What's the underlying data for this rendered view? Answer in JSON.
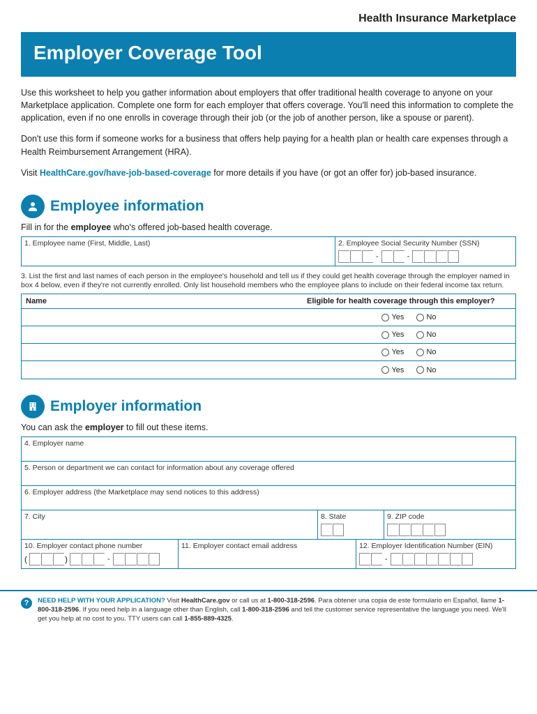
{
  "brand": "Health Insurance Marketplace",
  "title": "Employer Coverage Tool",
  "intro": {
    "p1": "Use this worksheet to help you gather information about employers that offer traditional health coverage to anyone on your Marketplace application. Complete one form for each employer that offers coverage. You'll need this information to complete the application, even if no one enrolls in coverage through their job (or the job of another person, like a spouse or parent).",
    "p2": "Don't use this form if someone works for a business that offers help paying for a health plan or health care expenses through a Health Reimbursement Arrangement (HRA).",
    "p3a": "Visit ",
    "p3link": "HealthCare.gov/have-job-based-coverage",
    "p3b": " for more details if you have (or got an offer for) job-based insurance."
  },
  "employee": {
    "heading": "Employee information",
    "sub_pre": "Fill in for the ",
    "sub_bold": "employee",
    "sub_post": " who's offered job-based health coverage.",
    "f1": "1. Employee name (First, Middle, Last)",
    "f2": "2. Employee Social Security Number (SSN)",
    "note3": "3. List the first and last names of each person in the employee's household and tell us if they could get health coverage through the employer named in box 4 below, even if they're not currently enrolled. Only list household members who the employee plans to include on their federal income tax return.",
    "col_name": "Name",
    "col_elig": "Eligible for health coverage through this employer?",
    "yes": "Yes",
    "no": "No"
  },
  "employer": {
    "heading": "Employer information",
    "sub_pre": "You can ask the ",
    "sub_bold": "employer",
    "sub_post": " to fill out these items.",
    "f4": "4. Employer name",
    "f5": "5. Person or department we can contact for information about any coverage offered",
    "f6": "6. Employer address (the Marketplace may send notices to this address)",
    "f7": "7. City",
    "f8": "8. State",
    "f9": "9. ZIP code",
    "f10": "10. Employer contact phone number",
    "f11": "11. Employer contact email address",
    "f12": "12. Employer Identification Number (EIN)"
  },
  "footer": {
    "lead": "NEED HELP WITH YOUR APPLICATION?",
    "t1": " Visit ",
    "link": "HealthCare.gov",
    "t2": " or call us at ",
    "ph1": "1-800-318-2596",
    "t3": ". Para obtener una copia de este formulario en Español, llame ",
    "ph2": "1-800-318-2596",
    "t4": ". If you need help in a language other than English, call ",
    "ph3": "1-800-318-2596",
    "t5": " and tell the customer service representative the language you need. We'll get you help at no cost to you. TTY users can call ",
    "ph4": "1-855-889-4325",
    "t6": "."
  }
}
